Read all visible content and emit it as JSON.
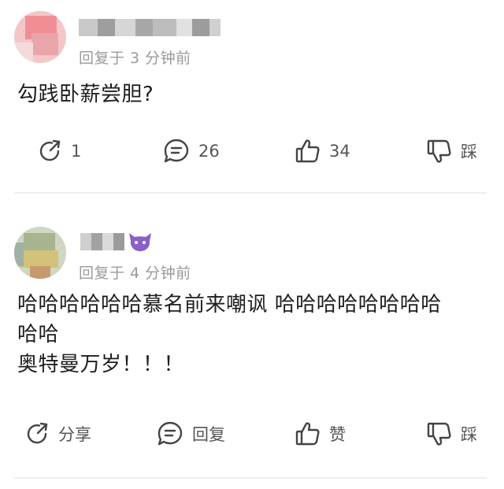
{
  "comments": [
    {
      "time_label": "回复于 3 分钟前",
      "text": "勾践卧薪尝胆?",
      "actions": {
        "share": "1",
        "reply": "26",
        "like": "34",
        "dislike": "踩"
      }
    },
    {
      "time_label": "回复于 4 分钟前",
      "text_lines": [
        "哈哈哈哈哈哈慕名前来嘲讽 哈哈哈哈哈哈哈哈",
        "哈哈",
        "奥特曼万岁！！！"
      ],
      "actions": {
        "share": "分享",
        "reply": "回复",
        "like": "赞",
        "dislike": "踩"
      }
    }
  ],
  "icons": [
    "share-icon",
    "comment-icon",
    "thumbs-up-icon",
    "thumbs-down-icon",
    "devil-badge-icon"
  ],
  "colors": {
    "text": "#1e1e1e",
    "meta": "#9a9a9a",
    "icon": "#444444",
    "divider": "#eeeeee",
    "badge": "#8b5fc9"
  }
}
